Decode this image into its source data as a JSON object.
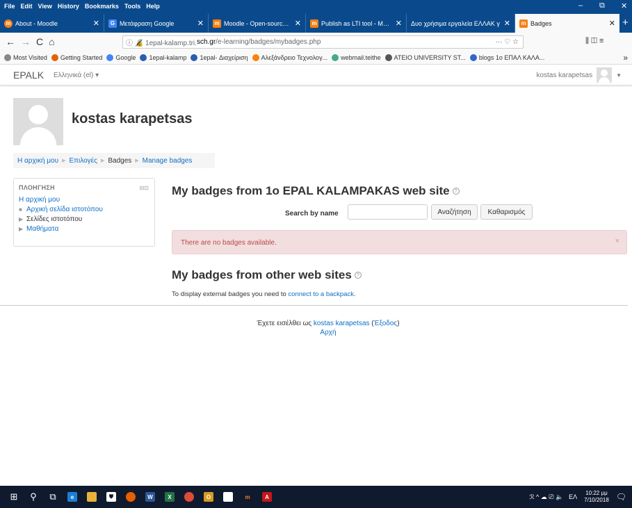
{
  "menubar": {
    "items": [
      "File",
      "Edit",
      "View",
      "History",
      "Bookmarks",
      "Tools",
      "Help"
    ],
    "controls": [
      "–",
      "⧉",
      "✕"
    ]
  },
  "tabs": [
    {
      "title": "About - Moodle",
      "icon": "moodle-icon",
      "color": "#f98012",
      "glyph": "m"
    },
    {
      "title": "Μετάφραση Google",
      "icon": "google-translate-icon",
      "color": "#4285f4",
      "glyph": "G"
    },
    {
      "title": "Moodle - Open-source lear",
      "icon": "moodle-icon",
      "color": "#f98012",
      "glyph": "m"
    },
    {
      "title": "Publish as LTI tool - Moodle",
      "icon": "moodle-docs-icon",
      "color": "#f98012",
      "glyph": "m"
    },
    {
      "title": "Δυο χρήσιμα εργαλεία ΕΛΛΑΚ γ",
      "icon": "",
      "color": "",
      "glyph": ""
    },
    {
      "title": "Badges",
      "icon": "moodle-icon",
      "color": "#f98012",
      "glyph": "m",
      "active": true
    }
  ],
  "new_tab": "+",
  "nav": {
    "back": "←",
    "forward": "→",
    "reload": "C",
    "home": "⌂",
    "url_prefix": "ⓘ 🔏 1epal-kalamp.tri.",
    "url_domain": "sch.gr",
    "url_path": "/e-learning/badges/mybadges.php",
    "url_actions": "··· ♡ ☆",
    "right_icons": "⫼  ◫  ≡"
  },
  "bookmarks": [
    {
      "label": "Most Visited",
      "color": "#888"
    },
    {
      "label": "Getting Started",
      "color": "#e66000"
    },
    {
      "label": "Google",
      "color": "#4285f4"
    },
    {
      "label": "1epal-kalamp",
      "color": "#2a5db0"
    },
    {
      "label": "1epal- Διαχείριση",
      "color": "#2a5db0"
    },
    {
      "label": "Αλεξάνδρειο Τεχνολογ...",
      "color": "#f98012"
    },
    {
      "label": "webmail.teithe",
      "color": "#4a8"
    },
    {
      "label": "ATEIO UNIVERSITY ST...",
      "color": "#555"
    },
    {
      "label": "blogs 1o ΕΠΑΛ ΚΑΛΑ...",
      "color": "#36c"
    }
  ],
  "bookmarks_more": "»",
  "moodle": {
    "brand": "EPALK",
    "language": "Ελληνικά (el) ▾",
    "user": "kostas karapetsas"
  },
  "profile": {
    "name": "kostas karapetsas"
  },
  "breadcrumb": [
    "Η αρχική μου",
    "Επιλογές",
    "Badges",
    "Manage badges"
  ],
  "navigation": {
    "title": "ΠΛΟΗΓΗΣΗ",
    "dock": "⊟⊡",
    "home": "Η αρχική μου",
    "items": [
      {
        "bullet": "■",
        "label": "Αρχική σελίδα ιστοτόπου",
        "link": true
      },
      {
        "bullet": "▶",
        "label": "Σελίδες ιστοτόπου",
        "link": false
      },
      {
        "bullet": "▶",
        "label": "Μαθήματα",
        "link": true
      }
    ]
  },
  "main": {
    "heading_local": "My badges from 1o EPAL KALAMPAKAS web site",
    "search_label": "Search by name",
    "search_value": "",
    "search_button": "Αναζήτηση",
    "clear_button": "Καθαρισμός",
    "alert": "There are no badges available.",
    "alert_close": "×",
    "heading_external": "My badges from other web sites",
    "ext_msg_prefix": "To display external badges you need to ",
    "ext_msg_link": "connect to a backpack",
    "ext_msg_suffix": "."
  },
  "footer": {
    "prefix": "Έχετε εισέλθει ως ",
    "user": "kostas karapetsas",
    "logout_open": " (",
    "logout": "Έξοδος",
    "logout_close": ")",
    "home": "Αρχή"
  },
  "taskbar": {
    "clock_time": "10:22 μμ",
    "clock_date": "7/10/2018",
    "lang": "ΕΛ",
    "tray": "ℛ  ^  ☁  ⎚  🔈",
    "notif": "🗨"
  }
}
